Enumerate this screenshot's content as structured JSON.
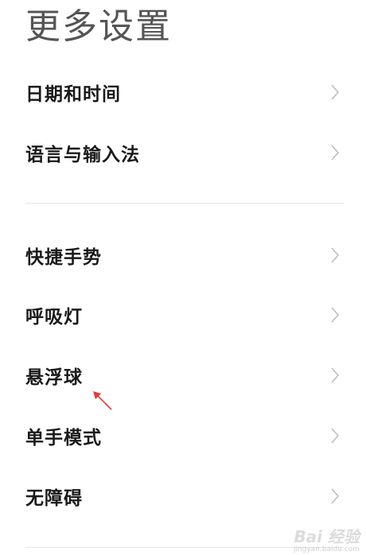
{
  "header": {
    "title": "更多设置"
  },
  "groups": [
    {
      "items": [
        {
          "label": "日期和时间",
          "icon": "chevron-right-icon"
        },
        {
          "label": "语言与输入法",
          "icon": "chevron-right-icon"
        }
      ]
    },
    {
      "items": [
        {
          "label": "快捷手势",
          "icon": "chevron-right-icon"
        },
        {
          "label": "呼吸灯",
          "icon": "chevron-right-icon"
        },
        {
          "label": "悬浮球",
          "icon": "chevron-right-icon"
        },
        {
          "label": "单手模式",
          "icon": "chevron-right-icon"
        },
        {
          "label": "无障碍",
          "icon": "chevron-right-icon"
        }
      ]
    }
  ],
  "colors": {
    "chevron": "#bdbdbd",
    "divider": "#e6e6e6",
    "annotation_arrow": "#e53935"
  },
  "watermark": {
    "brand": "Bai 经验",
    "url": "jingyan.baidu.com"
  }
}
